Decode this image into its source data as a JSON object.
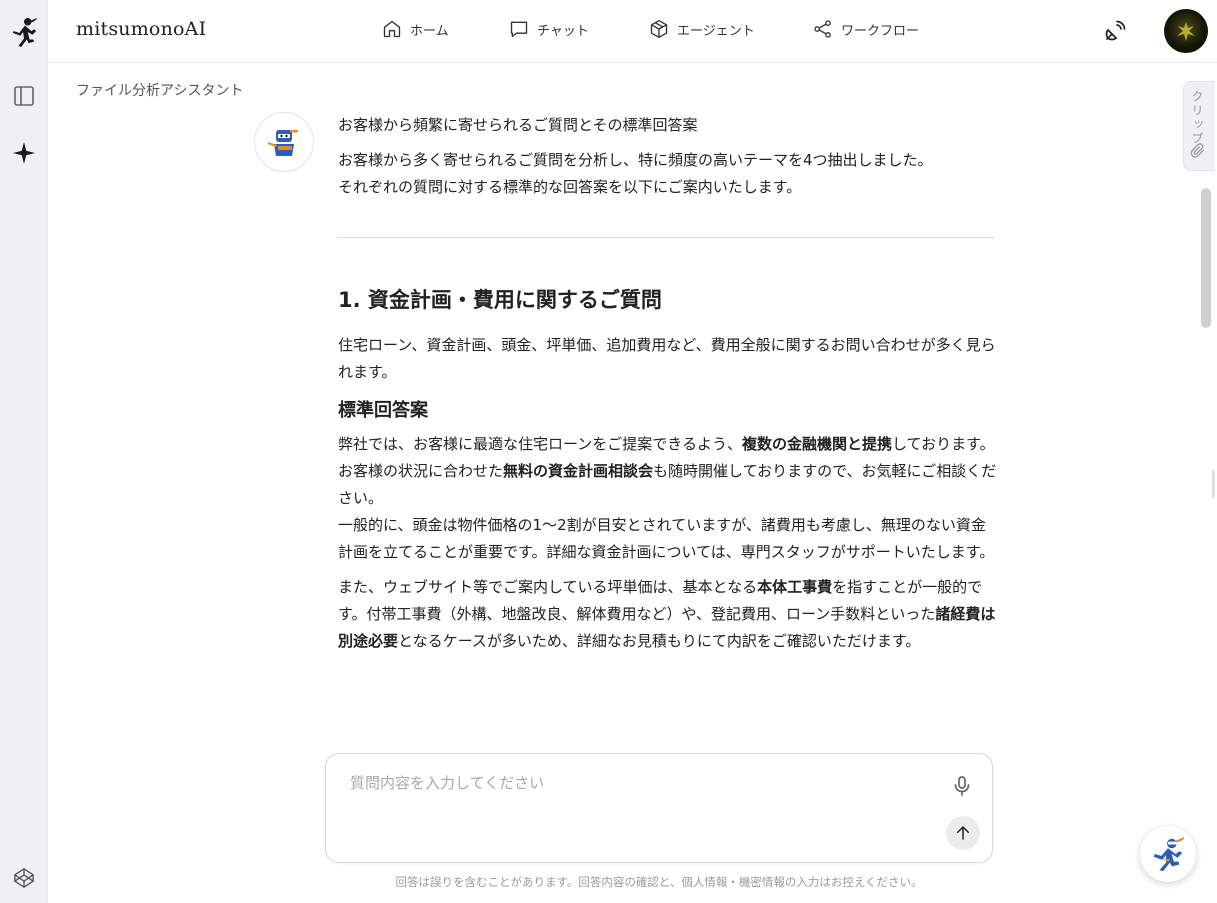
{
  "app": {
    "brand": "mitsumonoAI"
  },
  "nav": [
    {
      "label": "ホーム",
      "icon": "home-icon"
    },
    {
      "label": "チャット",
      "icon": "chat-icon"
    },
    {
      "label": "エージェント",
      "icon": "cube-icon"
    },
    {
      "label": "ワークフロー",
      "icon": "workflow-icon"
    }
  ],
  "breadcrumb": "ファイル分析アシスタント",
  "side_tab": {
    "label": "クリップ"
  },
  "message": {
    "title": "お客様から頻繁に寄せられるご質問とその標準回答案",
    "intro_1": "お客様から多く寄せられるご質問を分析し、特に頻度の高いテーマを4つ抽出しました。",
    "intro_2": "それぞれの質問に対する標準的な回答案を以下にご案内いたします。",
    "section_heading": "1. 資金計画・費用に関するご質問",
    "section_desc": "住宅ローン、資金計画、頭金、坪単価、追加費用など、費用全般に関するお問い合わせが多く見られます。",
    "answer_heading": "標準回答案",
    "p1_a": "弊社では、お客様に最適な住宅ローンをご提案できるよう、",
    "p1_b": "複数の金融機関と提携",
    "p1_c": "しております。",
    "p2_a": "お客様の状況に合わせた",
    "p2_b": "無料の資金計画相談会",
    "p2_c": "も随時開催しておりますので、お気軽にご相談ください。",
    "p3": "一般的に、頭金は物件価格の1〜2割が目安とされていますが、諸費用も考慮し、無理のない資金計画を立てることが重要です。詳細な資金計画については、専門スタッフがサポートいたします。",
    "p4_a": "また、ウェブサイト等でご案内している坪単価は、基本となる",
    "p4_b": "本体工事費",
    "p4_c": "を指すことが一般的です。付帯工事費（外構、地盤改良、解体費用など）や、登記費用、ローン手数料といった",
    "p4_d": "諸経費は別途必要",
    "p4_e": "となるケースが多いため、詳細なお見積もりにて内訳をご確認いただけます。"
  },
  "input": {
    "placeholder": "質問内容を入力してください",
    "value": ""
  },
  "disclaimer": "回答は誤りを含むことがあります。回答内容の確認と、個人情報・機密情報の入力はお控えください。",
  "colors": {
    "rail_bg": "#eef0f3",
    "text": "#1f1f1f",
    "muted": "#9a9a9a",
    "accent_blue": "#2b5fb4"
  }
}
